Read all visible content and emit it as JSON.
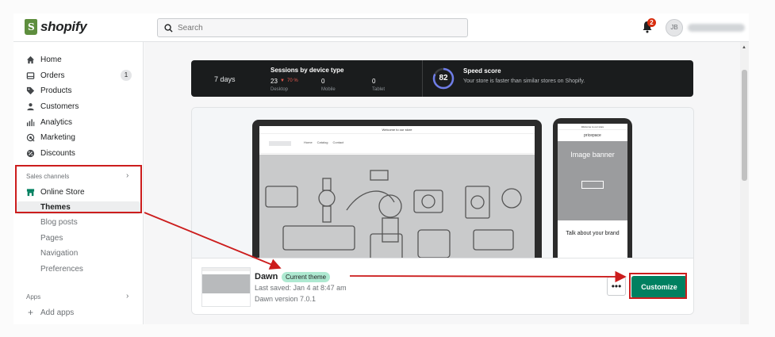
{
  "topbar": {
    "brand": "shopify",
    "search_placeholder": "Search",
    "notification_count": "2",
    "avatar_initials": "JB"
  },
  "sidebar": {
    "items": [
      {
        "label": "Home",
        "icon": "home-icon"
      },
      {
        "label": "Orders",
        "icon": "orders-icon",
        "badge": "1"
      },
      {
        "label": "Products",
        "icon": "tag-icon"
      },
      {
        "label": "Customers",
        "icon": "person-icon"
      },
      {
        "label": "Analytics",
        "icon": "bar-chart-icon"
      },
      {
        "label": "Marketing",
        "icon": "target-icon"
      },
      {
        "label": "Discounts",
        "icon": "discount-icon"
      }
    ],
    "sales_channels_label": "Sales channels",
    "online_store_label": "Online Store",
    "sub_items": [
      "Themes",
      "Blog posts",
      "Pages",
      "Navigation",
      "Preferences"
    ],
    "apps_label": "Apps",
    "add_apps_label": "Add apps"
  },
  "stats": {
    "period": "7 days",
    "sessions_title": "Sessions by device type",
    "desktop_value": "23",
    "desktop_change": "70 %",
    "desktop_label": "Desktop",
    "mobile_value": "0",
    "mobile_label": "Mobile",
    "tablet_value": "0",
    "tablet_label": "Tablet",
    "speed_score": "82",
    "speed_title": "Speed score",
    "speed_desc": "Your store is faster than similar stores on Shopify."
  },
  "preview": {
    "announcement": "Welcome to our store",
    "nav": [
      "Home",
      "Catalog",
      "Contact"
    ],
    "phone_announcement": "Welcome to our store",
    "phone_store_name": "pricepace",
    "phone_hero_title": "Image banner",
    "phone_talk": "Talk about your brand"
  },
  "theme": {
    "name": "Dawn",
    "badge": "Current theme",
    "saved": "Last saved: Jan 4 at 8:47 am",
    "version": "Dawn version 7.0.1",
    "more_label": "•••",
    "customize_label": "Customize"
  },
  "colors": {
    "brand_green": "#008060",
    "annotation_red": "#cc1d1d",
    "badge_green": "#aee9d1"
  }
}
